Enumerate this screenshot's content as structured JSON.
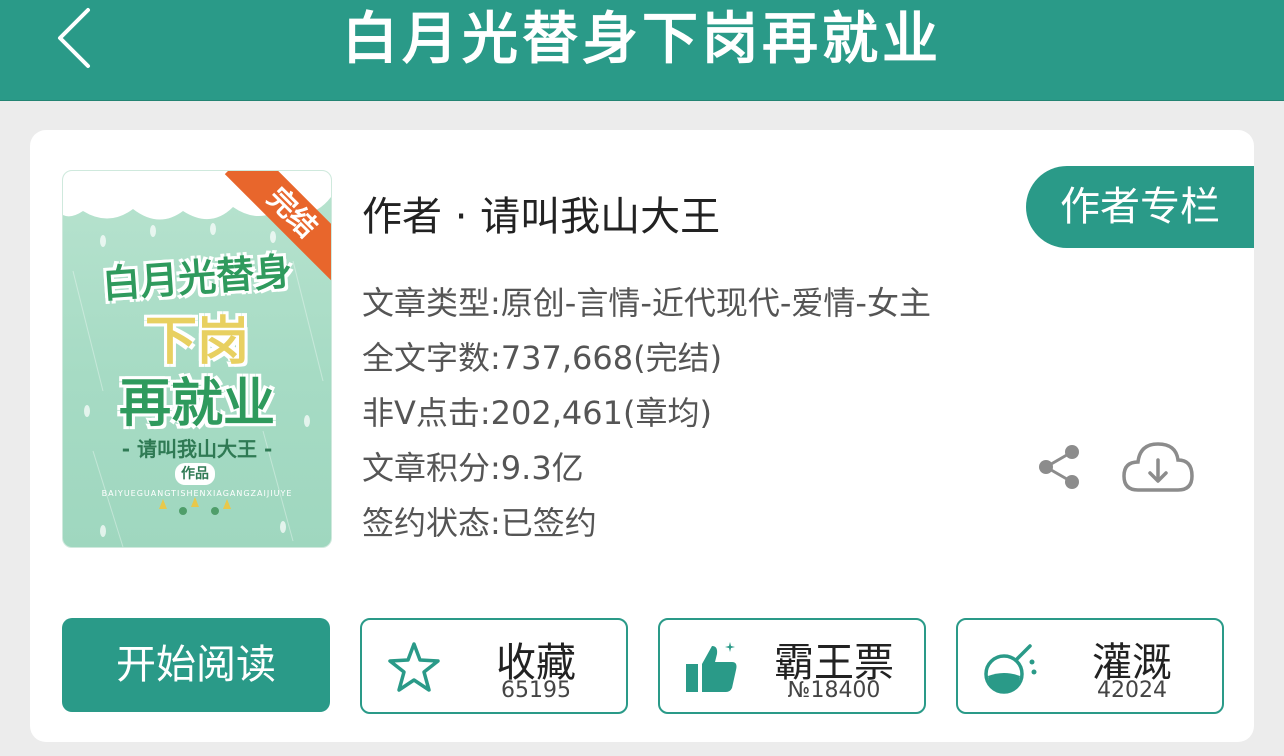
{
  "header": {
    "title": "白月光替身下岗再就业",
    "back_icon": "chevron-left-icon"
  },
  "cover": {
    "ribbon": "完结",
    "title_line1": "白月光替身",
    "title_line2": "下岗",
    "title_line3": "再就业",
    "author": "- 请叫我山大王 -",
    "zuo": "作品",
    "pinyin": "BAIYUEGUANGTISHENXIAGANGZAIJIUYE"
  },
  "book": {
    "author_line": "作者 · 请叫我山大王",
    "column_button": "作者专栏",
    "info": [
      "文章类型:原创-言情-近代现代-爱情-女主",
      "全文字数:737,668(完结)",
      "非Ⅴ点击:202,461(章均)",
      "文章积分:9.3亿",
      "签约状态:已签约"
    ]
  },
  "actions": {
    "read": "开始阅读",
    "collect": {
      "label": "收藏",
      "count": "65195",
      "icon": "star-icon"
    },
    "ticket": {
      "label": "霸王票",
      "count": "№18400",
      "icon": "thumbs-up-icon"
    },
    "water": {
      "label": "灌溉",
      "count": "42024",
      "icon": "flask-icon"
    }
  },
  "colors": {
    "accent": "#2a9a88",
    "ribbon": "#e8662c"
  }
}
